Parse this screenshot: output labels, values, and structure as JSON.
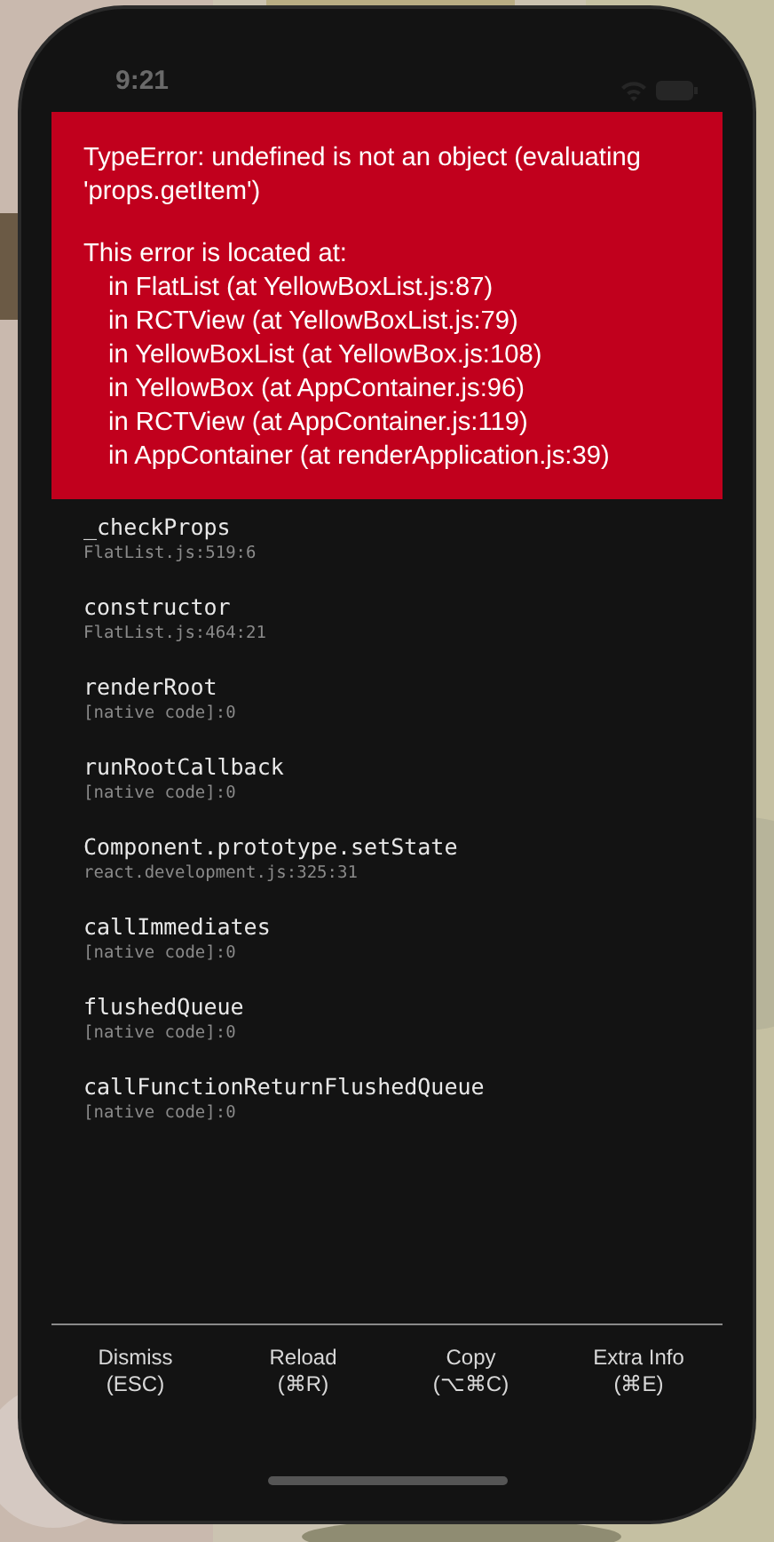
{
  "status_bar": {
    "time": "9:21"
  },
  "error": {
    "message": "TypeError: undefined is not an object (evaluating 'props.getItem')",
    "location_title": "This error is located at:",
    "location_lines": [
      "in FlatList (at YellowBoxList.js:87)",
      "in RCTView (at YellowBoxList.js:79)",
      "in YellowBoxList (at YellowBox.js:108)",
      "in YellowBox (at AppContainer.js:96)",
      "in RCTView (at AppContainer.js:119)",
      "in AppContainer (at renderApplication.js:39)"
    ]
  },
  "stack": [
    {
      "method": "_checkProps",
      "location": "FlatList.js:519:6"
    },
    {
      "method": "constructor",
      "location": "FlatList.js:464:21"
    },
    {
      "method": "renderRoot",
      "location": "[native code]:0"
    },
    {
      "method": "runRootCallback",
      "location": "[native code]:0"
    },
    {
      "method": "Component.prototype.setState",
      "location": "react.development.js:325:31"
    },
    {
      "method": "callImmediates",
      "location": "[native code]:0"
    },
    {
      "method": "flushedQueue",
      "location": "[native code]:0"
    },
    {
      "method": "callFunctionReturnFlushedQueue",
      "location": "[native code]:0"
    }
  ],
  "buttons": [
    {
      "label": "Dismiss",
      "shortcut": "(ESC)"
    },
    {
      "label": "Reload",
      "shortcut": "(⌘R)"
    },
    {
      "label": "Copy",
      "shortcut": "(⌥⌘C)"
    },
    {
      "label": "Extra Info",
      "shortcut": "(⌘E)"
    }
  ]
}
